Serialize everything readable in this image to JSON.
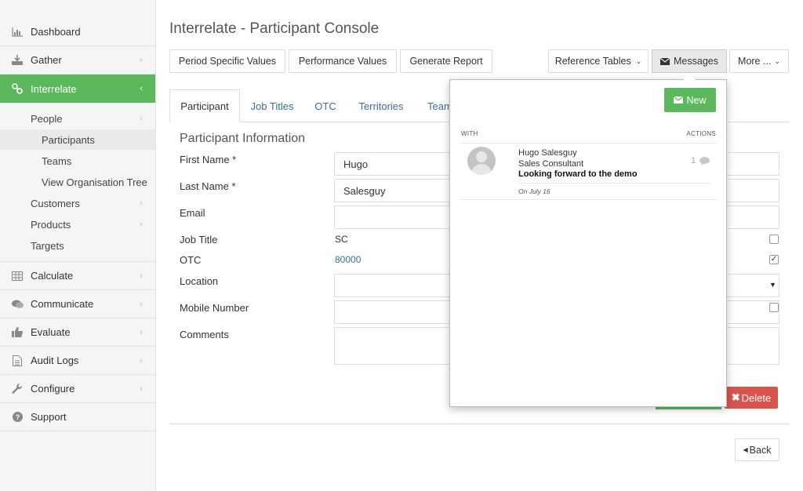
{
  "sidebar": {
    "items": [
      {
        "label": "Dashboard",
        "icon": "bar-chart-icon"
      },
      {
        "label": "Gather",
        "icon": "download-icon"
      },
      {
        "label": "Interrelate",
        "icon": "link-icon"
      },
      {
        "label": "Calculate",
        "icon": "table-icon"
      },
      {
        "label": "Communicate",
        "icon": "comments-icon"
      },
      {
        "label": "Evaluate",
        "icon": "thumbs-up-icon"
      },
      {
        "label": "Audit Logs",
        "icon": "file-icon"
      },
      {
        "label": "Configure",
        "icon": "wrench-icon"
      },
      {
        "label": "Support",
        "icon": "question-icon"
      }
    ],
    "submenu": {
      "people": "People",
      "participants": "Participants",
      "teams": "Teams",
      "org_tree": "View Organisation Tree",
      "customers": "Customers",
      "products": "Products",
      "targets": "Targets"
    }
  },
  "header": {
    "title": "Interrelate - Participant Console"
  },
  "toolbar": {
    "period": "Period Specific Values",
    "performance": "Performance Values",
    "report": "Generate Report",
    "reference": "Reference Tables",
    "messages": "Messages",
    "more": "More ..."
  },
  "tabs": [
    "Participant",
    "Job Titles",
    "OTC",
    "Territories",
    "Team"
  ],
  "form": {
    "section_title": "Participant Information",
    "first_name_label": "First Name *",
    "first_name_value": "Hugo",
    "last_name_label": "Last Name *",
    "last_name_value": "Salesguy",
    "email_label": "Email",
    "job_title_label": "Job Title",
    "job_title_value": "SC",
    "otc_label": "OTC",
    "otc_value": "80000",
    "location_label": "Location",
    "mobile_label": "Mobile Number",
    "comments_label": "Comments"
  },
  "actions": {
    "delete": "Delete",
    "back": "Back"
  },
  "messages_popup": {
    "new_label": "New",
    "col_with": "WITH",
    "col_actions": "ACTIONS",
    "items": [
      {
        "name": "Hugo Salesguy",
        "role": "Sales Consultant",
        "subject": "Looking forward to the demo",
        "date": "On July 16",
        "count": "1"
      }
    ]
  },
  "colors": {
    "accent_green": "#5cb85c",
    "danger_red": "#d9534f",
    "link_blue": "#3a6f9a"
  }
}
